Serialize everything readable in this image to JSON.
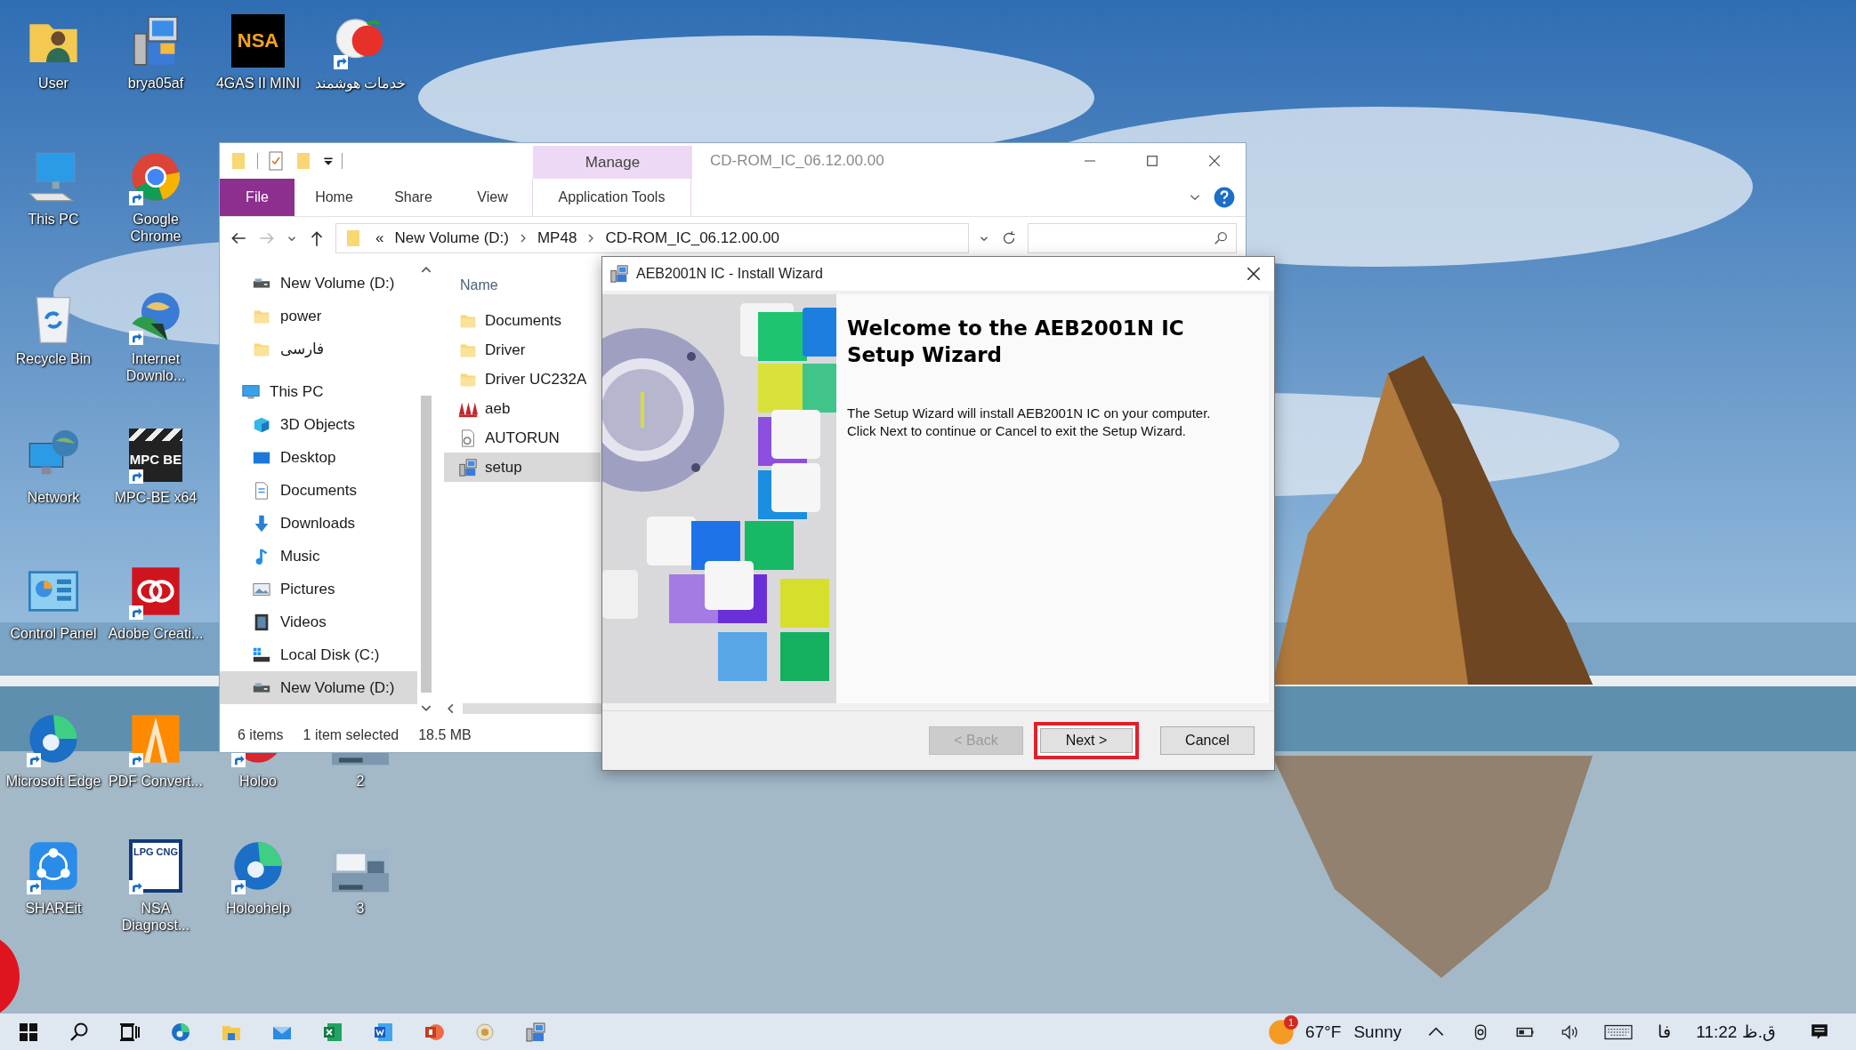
{
  "desktop_icons": [
    {
      "label": "User",
      "shortcut": false
    },
    {
      "label": "brya05af",
      "shortcut": false
    },
    {
      "label": "4GAS II MINI",
      "logo_text": "NSA",
      "shortcut": false
    },
    {
      "label": "خدمات هوشمند",
      "shortcut": true
    },
    {
      "label": "This PC",
      "shortcut": false
    },
    {
      "label": "Google Chrome",
      "shortcut": true
    },
    {
      "label": "Recycle Bin",
      "shortcut": false
    },
    {
      "label": "Internet Downlo...",
      "shortcut": true
    },
    {
      "label": "Network",
      "shortcut": false
    },
    {
      "label": "MPC-BE x64",
      "logo_text": "MPC BE",
      "shortcut": true
    },
    {
      "label": "Control Panel",
      "shortcut": false
    },
    {
      "label": "Adobe Creati...",
      "shortcut": true
    },
    {
      "label": "Microsoft Edge",
      "shortcut": true
    },
    {
      "label": "PDF Convert...",
      "shortcut": true
    },
    {
      "label": "Holoo",
      "shortcut": true
    },
    {
      "label": "2",
      "shortcut": false
    },
    {
      "label": "SHAREit",
      "shortcut": true
    },
    {
      "label": "NSA Diagnost...",
      "logo_text": "LPG CNG",
      "shortcut": true
    },
    {
      "label": "Holoohelp",
      "shortcut": true
    },
    {
      "label": "3",
      "shortcut": false
    }
  ],
  "explorer": {
    "title": "CD-ROM_IC_06.12.00.00",
    "context_tab_group": "Manage",
    "ribbon_tabs": [
      {
        "label": "File",
        "kind": "file"
      },
      {
        "label": "Home",
        "kind": "tab"
      },
      {
        "label": "Share",
        "kind": "tab"
      },
      {
        "label": "View",
        "kind": "tab"
      },
      {
        "label": "Application Tools",
        "kind": "contextual"
      }
    ],
    "address": {
      "overflow": "«",
      "path": [
        "New Volume (D:)",
        "MP48",
        "CD-ROM_IC_06.12.00.00"
      ]
    },
    "nav_quick_access": [
      {
        "label": "New Volume (D:)",
        "selected": false
      },
      {
        "label": "power",
        "selected": false
      },
      {
        "label": "فارسی",
        "selected": false
      }
    ],
    "nav_this_pc": {
      "label": "This PC",
      "selected": false,
      "children": [
        {
          "label": "3D Objects",
          "selected": false
        },
        {
          "label": "Desktop",
          "selected": false
        },
        {
          "label": "Documents",
          "selected": false
        },
        {
          "label": "Downloads",
          "selected": false
        },
        {
          "label": "Music",
          "selected": false
        },
        {
          "label": "Pictures",
          "selected": false
        },
        {
          "label": "Videos",
          "selected": false
        },
        {
          "label": "Local Disk (C:)",
          "selected": false
        },
        {
          "label": "New Volume (D:)",
          "selected": true
        }
      ]
    },
    "column_header": "Name",
    "files": [
      {
        "name": "Documents",
        "selected": false
      },
      {
        "name": "Driver",
        "selected": false
      },
      {
        "name": "Driver UC232A",
        "selected": false
      },
      {
        "name": "aeb",
        "selected": false
      },
      {
        "name": "AUTORUN",
        "selected": false
      },
      {
        "name": "setup",
        "selected": true
      }
    ],
    "status": {
      "item_count": "6 items",
      "selection": "1 item selected",
      "size": "18.5 MB"
    }
  },
  "wizard": {
    "title": "AEB2001N IC - Install Wizard",
    "heading": "Welcome to the AEB2001N IC Setup Wizard",
    "body": [
      "The Setup Wizard will install AEB2001N IC on your computer.",
      "Click Next to continue or Cancel to exit the Setup Wizard."
    ],
    "buttons": [
      {
        "label": "< Back",
        "disabled": true,
        "highlighted": false
      },
      {
        "label": "Next >",
        "disabled": false,
        "highlighted": true
      },
      {
        "label": "Cancel",
        "disabled": false,
        "highlighted": false
      }
    ]
  },
  "taskbar": {
    "weather": {
      "badge": "1",
      "temperature": "67°F",
      "condition": "Sunny"
    },
    "language": "فا",
    "clock": "11:22 ق.ظ"
  }
}
